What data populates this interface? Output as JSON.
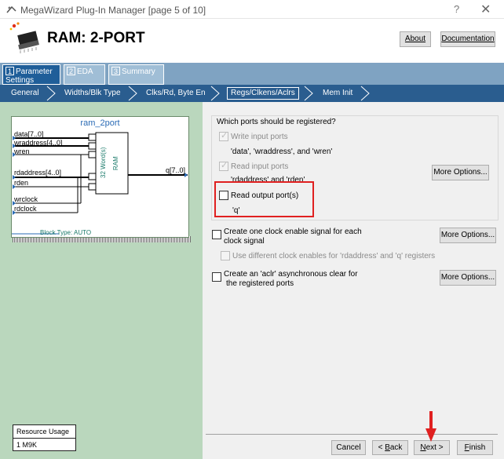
{
  "window": {
    "title": "MegaWizard Plug-In Manager [page 5 of 10]",
    "help": "?",
    "close": "✕"
  },
  "header": {
    "title": "RAM: 2-PORT",
    "about": "About",
    "documentation": "Documentation"
  },
  "tabs": [
    {
      "num": "1",
      "label": "Parameter Settings",
      "active": true
    },
    {
      "num": "2",
      "label": "EDA",
      "active": false
    },
    {
      "num": "3",
      "label": "Summary",
      "active": false
    }
  ],
  "steps": [
    "General",
    "Widths/Blk Type",
    "Clks/Rd, Byte En",
    "Regs/Clkens/Aclrs",
    "Mem Init"
  ],
  "diagram": {
    "title": "ram_2port",
    "ports_in": [
      "data[7..0]",
      "wraddress[4..0]",
      "wren",
      "rdaddress[4..0]",
      "rden",
      "wrclock",
      "rdclock"
    ],
    "port_out": "q[7..0]",
    "ram_label1": "32 Word(s)",
    "ram_label2": "RAM",
    "block_type": "Block Type: AUTO"
  },
  "resources": {
    "header": "Resource Usage",
    "value": "1 M9K"
  },
  "registered": {
    "group_label": "Which ports should be registered?",
    "write_input": "Write input ports",
    "write_input_desc": "'data', 'wraddress', and 'wren'",
    "read_input": "Read input ports",
    "read_input_desc": "'rdaddress' and 'rden'",
    "read_output": "Read output port(s)",
    "read_output_desc": "'q'",
    "more_options": "More Options..."
  },
  "clock_enable": {
    "line1": "Create one clock enable signal for each",
    "line2": "clock signal",
    "sub": "Use different clock enables for 'rdaddress' and 'q' registers",
    "more_options": "More Options..."
  },
  "aclr": {
    "line1": "Create an 'aclr' asynchronous clear for",
    "line2": "the registered ports",
    "more_options": "More Options..."
  },
  "footer": {
    "cancel": "Cancel",
    "back_pre": "< ",
    "back_u": "B",
    "back_post": "ack",
    "next_u": "N",
    "next_post": "ext >",
    "finish_u": "F",
    "finish_post": "inish"
  },
  "colors": {
    "accent": "#1f5e99",
    "highlight": "#e02020",
    "schematic_bg": "#bad7bd"
  }
}
